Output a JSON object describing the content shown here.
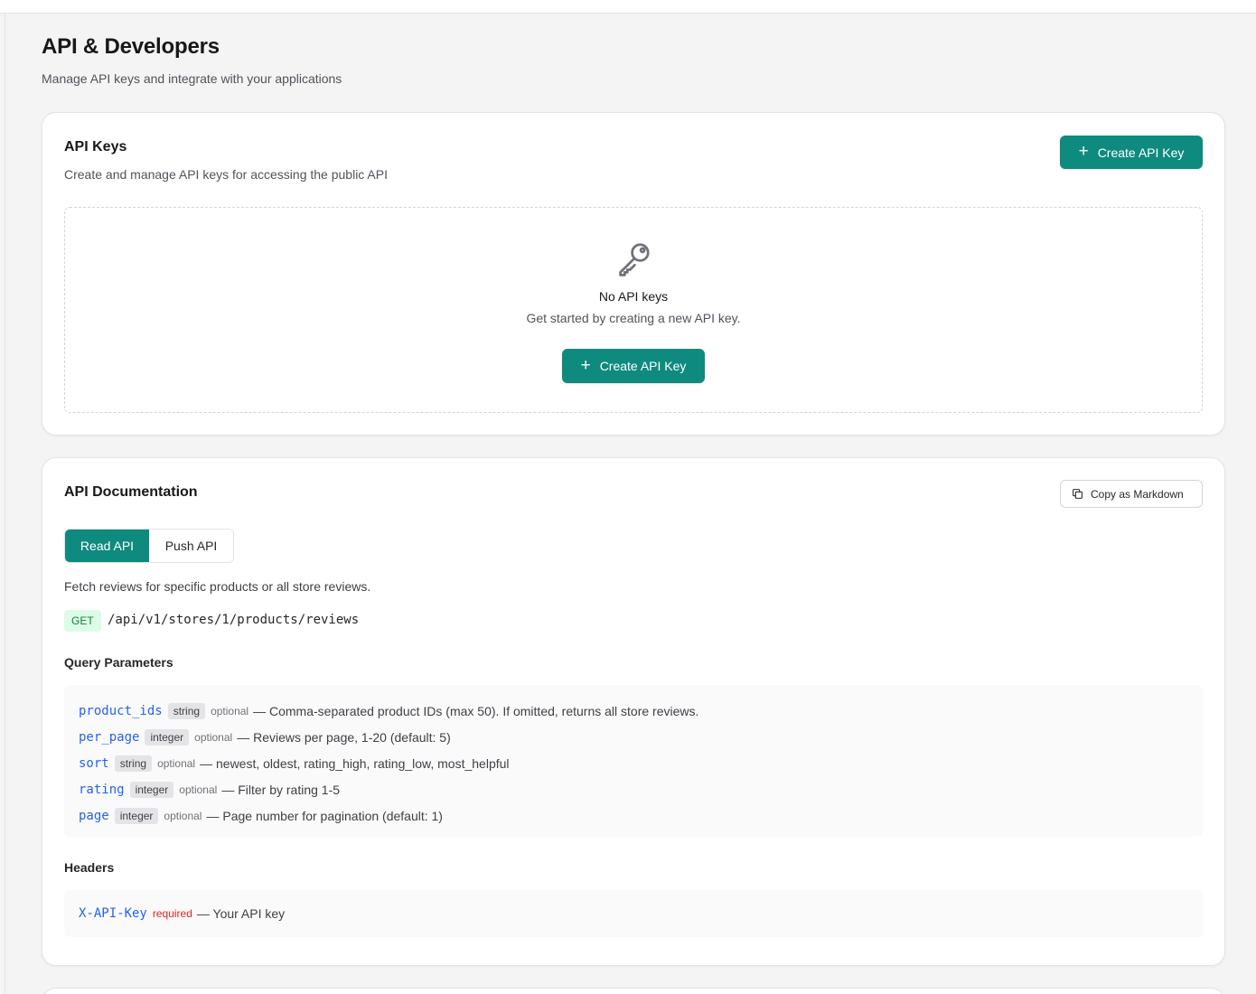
{
  "header": {
    "title": "API & Developers",
    "subtitle": "Manage API keys and integrate with your applications"
  },
  "api_keys": {
    "title": "API Keys",
    "description": "Create and manage API keys for accessing the public API",
    "create_button": "Create API Key",
    "empty_icon": "key-icon",
    "empty_title": "No API keys",
    "empty_description": "Get started by creating a new API key.",
    "empty_button": "Create API Key"
  },
  "docs": {
    "title": "API Documentation",
    "copy_button": "Copy as Markdown",
    "copy_icon": "copy-icon",
    "tabs": [
      {
        "label": "Read API",
        "active": true
      },
      {
        "label": "Push API",
        "active": false
      }
    ],
    "description": "Fetch reviews for specific products or all store reviews.",
    "method": "GET",
    "endpoint": "/api/v1/stores/1/products/reviews",
    "query_label": "Query Parameters",
    "query_params": [
      {
        "name": "product_ids",
        "type": "string",
        "flag": "optional",
        "desc": "— Comma-separated product IDs (max 50). If omitted, returns all store reviews."
      },
      {
        "name": "per_page",
        "type": "integer",
        "flag": "optional",
        "desc": "— Reviews per page, 1-20 (default: 5)"
      },
      {
        "name": "sort",
        "type": "string",
        "flag": "optional",
        "desc": "— newest, oldest, rating_high, rating_low, most_helpful"
      },
      {
        "name": "rating",
        "type": "integer",
        "flag": "optional",
        "desc": "— Filter by rating 1-5"
      },
      {
        "name": "page",
        "type": "integer",
        "flag": "optional",
        "desc": "— Page number for pagination (default: 1)"
      }
    ],
    "headers_label": "Headers",
    "headers": [
      {
        "name": "X-API-Key",
        "flag": "required",
        "desc": "— Your API key"
      }
    ]
  },
  "colors": {
    "accent": "#0f8a7e",
    "param_name": "#2563eb",
    "required": "#dc2626",
    "method_bg": "#dcfce7",
    "method_text": "#15803d"
  }
}
